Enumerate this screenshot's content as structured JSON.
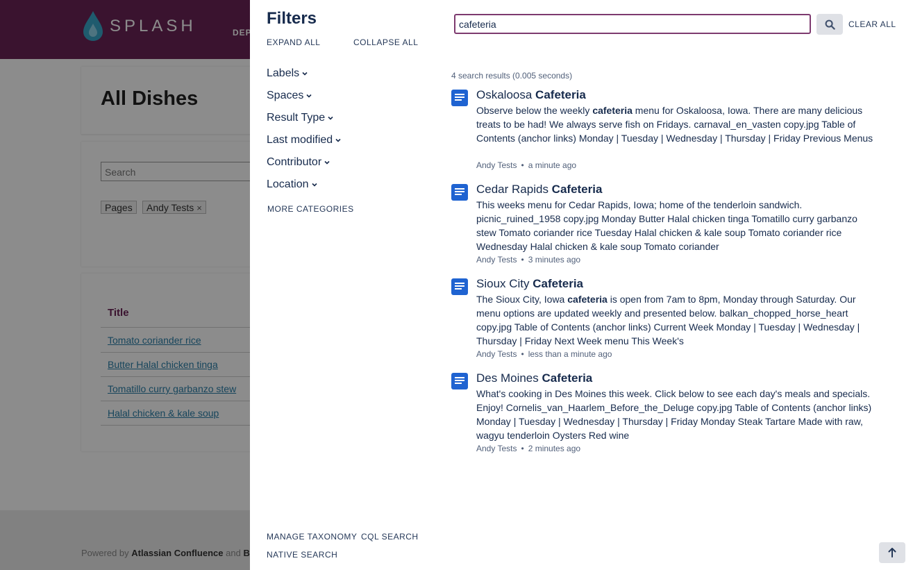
{
  "background": {
    "logo_text": "SPLASH",
    "nav_text": "DEP",
    "page_title": "All Dishes",
    "search_placeholder": "Search",
    "chips": [
      {
        "label": "Pages"
      },
      {
        "label": "Andy Tests",
        "remove": "×"
      }
    ],
    "table_header": "Title",
    "rows": [
      "Tomato coriander rice",
      "Butter Halal chicken tinga",
      "Tomatillo curry garbanzo stew",
      "Halal chicken & kale soup"
    ],
    "footer_prefix": "Powered by",
    "footer_product": "Atlassian Confluence",
    "footer_and": "and",
    "footer_b": "B",
    "brand_color": "#6b2457"
  },
  "panel": {
    "filters_title": "Filters",
    "expand_all": "EXPAND ALL",
    "collapse_all": "COLLAPSE ALL",
    "facets": [
      "Labels",
      "Spaces",
      "Result Type",
      "Last modified",
      "Contributor",
      "Location"
    ],
    "more_categories": "MORE CATEGORIES",
    "search_value": "cafeteria",
    "clear_all": "CLEAR ALL",
    "results_meta": "4 search results (0.005 seconds)",
    "results": [
      {
        "title_plain": "Oskaloosa ",
        "title_bold": "Cafeteria",
        "excerpt_before": "Observe below the weekly ",
        "excerpt_bold": "cafeteria",
        "excerpt_after": " menu for Oskaloosa, Iowa. There are many delicious treats to be had! We always serve fish on Fridays. carnaval_en_vasten copy.jpg Table of Contents (anchor links) Monday  |  Tuesday  |  Wednesday  |  Thursday  |  Friday Previous Menus",
        "author": "Andy Tests",
        "time": "a minute ago"
      },
      {
        "title_plain": "Cedar Rapids ",
        "title_bold": "Cafeteria",
        "excerpt_before": "This weeks menu for Cedar Rapids, Iowa; home of the tenderloin sandwich. picnic_ruined_1958 copy.jpg Monday  Butter Halal chicken tinga Tomatillo curry garbanzo stew Tomato coriander rice Tuesday  Halal chicken & kale soup Tomato coriander rice Wednesday  Halal chicken & kale soup Tomato coriander",
        "excerpt_bold": "",
        "excerpt_after": "",
        "author": "Andy Tests",
        "time": "3 minutes ago"
      },
      {
        "title_plain": "Sioux City ",
        "title_bold": "Cafeteria",
        "excerpt_before": "The Sioux City, Iowa ",
        "excerpt_bold": "cafeteria",
        "excerpt_after": " is open from 7am to 8pm, Monday through Saturday. Our menu options are updated weekly and presented below. balkan_chopped_horse_heart copy.jpg Table of Contents (anchor links) Current Week  Monday  |  Tuesday  |  Wednesday  |  Thursday  |  Friday Next Week menu This Week's",
        "author": "Andy Tests",
        "time": "less than a minute ago"
      },
      {
        "title_plain": "Des Moines ",
        "title_bold": "Cafeteria",
        "excerpt_before": "What's cooking in Des Moines this week. Click below to see each day's meals and specials. Enjoy! Cornelis_van_Haarlem_Before_the_Deluge copy.jpg Table of Contents (anchor links) Monday  |  Tuesday  |  Wednesday  |  Thursday  |  Friday Monday  Steak Tartare Made with raw, wagyu tenderloin Oysters Red wine",
        "excerpt_bold": "",
        "excerpt_after": "",
        "author": "Andy Tests",
        "time": "2 minutes ago"
      }
    ],
    "meta_separator": "•",
    "footer_links": [
      "MANAGE TAXONOMY",
      "CQL SEARCH",
      "NATIVE SEARCH"
    ],
    "icons": {
      "search": "search-icon",
      "scroll_top": "arrow-up-icon",
      "result": "page-icon",
      "facet": "chevron-down-icon"
    },
    "colors": {
      "accent": "#7d3a6f",
      "icon_blue": "#1f63d1",
      "text": "#172b4d"
    }
  }
}
